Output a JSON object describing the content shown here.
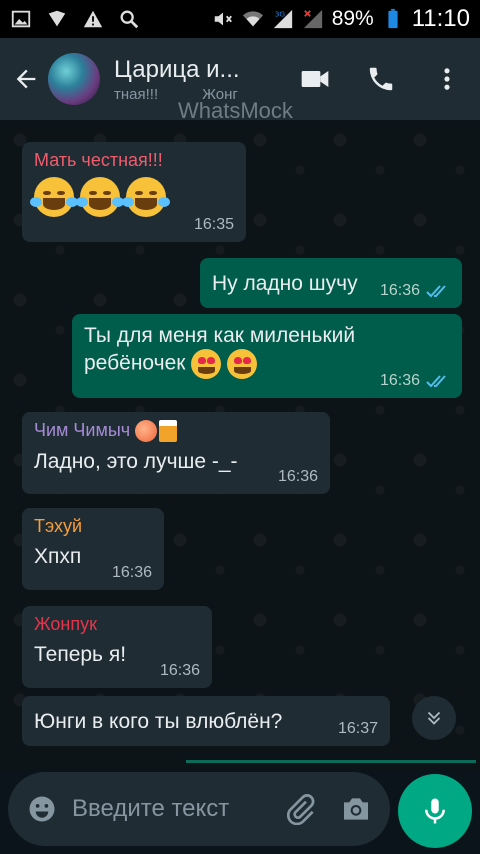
{
  "status_bar": {
    "battery": "89%",
    "time": "11:10",
    "network": "3G"
  },
  "header": {
    "title": "Царица и...",
    "subtitle_parts": [
      "тная!!!",
      "Жонг"
    ],
    "watermark": "WhatsMock"
  },
  "messages": [
    {
      "direction": "in",
      "sender": "Мать честная!!!",
      "sender_color": "#f15c6d",
      "text": "",
      "emojis": "tears-of-joy x3",
      "time": "16:35"
    },
    {
      "direction": "out",
      "text": "Ну ладно шучу",
      "time": "16:36"
    },
    {
      "direction": "out",
      "text_line1": "Ты для меня как миленький",
      "text_line2": "ребёночек",
      "emojis": "heart-eyes x2",
      "time": "16:36"
    },
    {
      "direction": "in",
      "sender": "Чим Чимыч",
      "sender_color": "#a78bd6",
      "text": "Ладно, это лучше -_-",
      "time": "16:36"
    },
    {
      "direction": "in",
      "sender": "Тэхуй",
      "sender_color": "#f59e3c",
      "text": "Хпхп",
      "time": "16:36"
    },
    {
      "direction": "in",
      "sender": "Жонпук",
      "sender_color": "#e8344a",
      "text": "Теперь я!",
      "time": "16:36"
    },
    {
      "direction": "in",
      "text": "Юнги в кого ты влюблён?",
      "time": "16:37"
    }
  ],
  "composer": {
    "placeholder": "Введите текст"
  },
  "colors": {
    "header_bg": "#1f2c34",
    "incoming_bg": "#1f2c34",
    "outgoing_bg": "#005c4b",
    "accent": "#00a884",
    "read_ticks": "#53bdeb"
  }
}
